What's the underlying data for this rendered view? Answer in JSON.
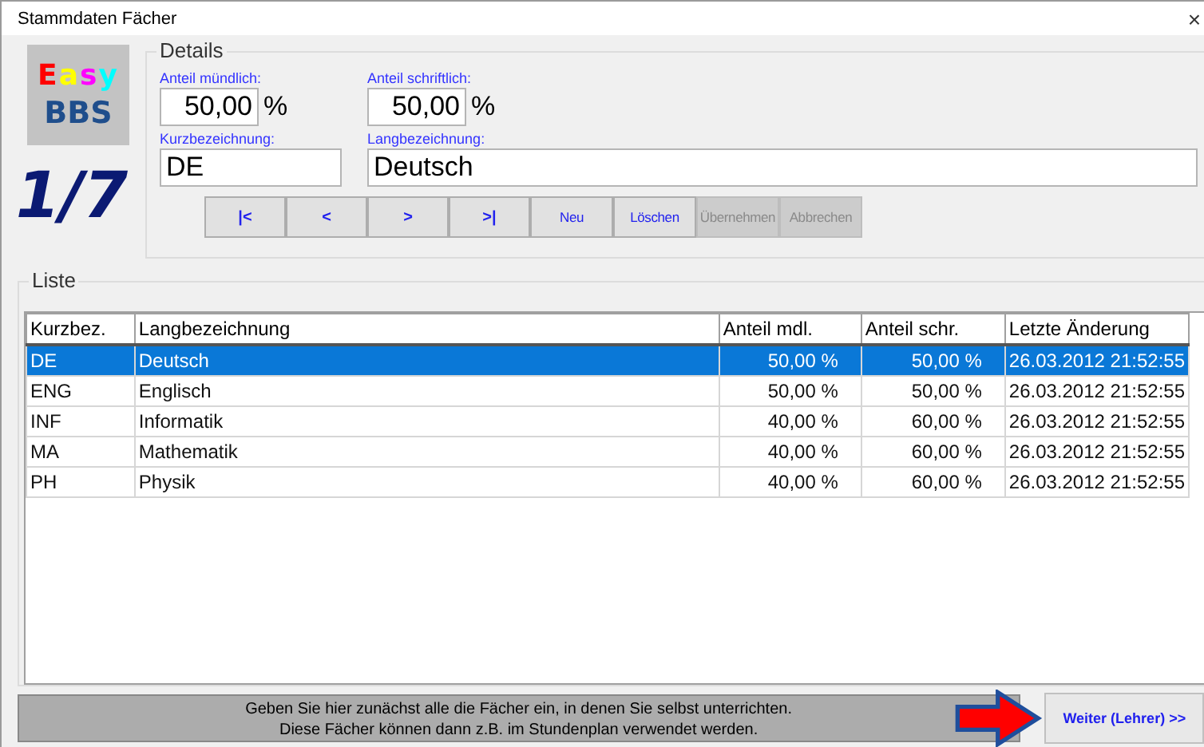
{
  "window": {
    "title": "Stammdaten Fächer",
    "close": "×"
  },
  "logo": {
    "word": "Easy",
    "sub": "BBS"
  },
  "record_counter": "1/7",
  "details": {
    "title": "Details",
    "fields": [
      {
        "label": "Anteil mündlich:",
        "value": "50,00",
        "unit": "%"
      },
      {
        "label": "Anteil schriftlich:",
        "value": "50,00",
        "unit": "%"
      },
      {
        "label": "Kurzbezeichnung:",
        "value": "DE"
      },
      {
        "label": "Langbezeichnung:",
        "value": "Deutsch"
      }
    ],
    "buttons": [
      {
        "label": "|<",
        "disabled": false,
        "kind": "nav"
      },
      {
        "label": "<",
        "disabled": false,
        "kind": "nav"
      },
      {
        "label": ">",
        "disabled": false,
        "kind": "nav"
      },
      {
        "label": ">|",
        "disabled": false,
        "kind": "nav"
      },
      {
        "label": "Neu",
        "disabled": false,
        "kind": "action"
      },
      {
        "label": "Löschen",
        "disabled": false,
        "kind": "action"
      },
      {
        "label": "Übernehmen",
        "disabled": true,
        "kind": "action"
      },
      {
        "label": "Abbrechen",
        "disabled": true,
        "kind": "action"
      }
    ]
  },
  "list": {
    "title": "Liste",
    "table": {
      "columns": [
        "Kurzbez.",
        "Langbezeichnung",
        "Anteil mdl.",
        "Anteil schr.",
        "Letzte Änderung"
      ],
      "rows": [
        {
          "cells": [
            "DE",
            "Deutsch",
            "50,00 %",
            "50,00 %",
            "26.03.2012 21:52:55"
          ],
          "selected": true
        },
        {
          "cells": [
            "ENG",
            "Englisch",
            "50,00 %",
            "50,00 %",
            "26.03.2012 21:52:55"
          ],
          "selected": false
        },
        {
          "cells": [
            "INF",
            "Informatik",
            "40,00 %",
            "60,00 %",
            "26.03.2012 21:52:55"
          ],
          "selected": false
        },
        {
          "cells": [
            "MA",
            "Mathematik",
            "40,00 %",
            "60,00 %",
            "26.03.2012 21:52:55"
          ],
          "selected": false
        },
        {
          "cells": [
            "PH",
            "Physik",
            "40,00 %",
            "60,00 %",
            "26.03.2012 21:52:55"
          ],
          "selected": false
        }
      ]
    }
  },
  "footer": {
    "message": "Geben Sie hier zunächst alle die Fächer ein, in denen Sie selbst unterrichten.\nDiese Fächer können dann z.B. im Stundenplan verwendet werden.",
    "next_button": "Weiter (Lehrer) >>"
  }
}
